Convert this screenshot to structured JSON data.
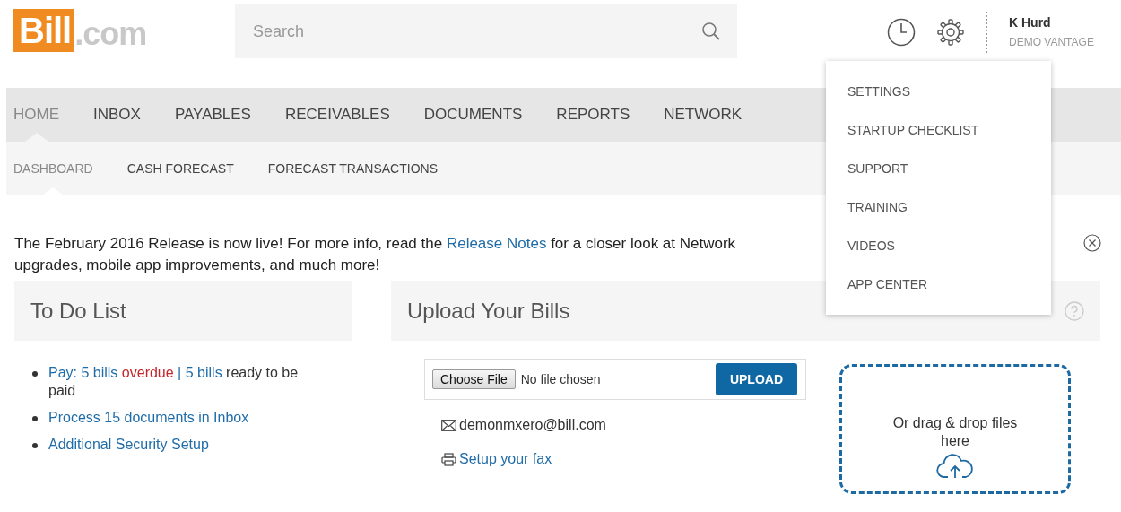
{
  "header": {
    "logo": {
      "brand": "Bill",
      "suffix": ".com"
    },
    "search": {
      "placeholder": "Search"
    },
    "user": {
      "name": "K Hurd",
      "company": "DEMO VANTAGE"
    }
  },
  "nav": {
    "items": [
      {
        "label": "HOME",
        "selected": true
      },
      {
        "label": "INBOX",
        "selected": false
      },
      {
        "label": "PAYABLES",
        "selected": false
      },
      {
        "label": "RECEIVABLES",
        "selected": false
      },
      {
        "label": "DOCUMENTS",
        "selected": false
      },
      {
        "label": "REPORTS",
        "selected": false
      },
      {
        "label": "NETWORK",
        "selected": false
      }
    ]
  },
  "subnav": {
    "items": [
      {
        "label": "DASHBOARD",
        "selected": true
      },
      {
        "label": "CASH FORECAST",
        "selected": false
      },
      {
        "label": "FORECAST TRANSACTIONS",
        "selected": false
      }
    ]
  },
  "settings_menu": {
    "items": [
      "SETTINGS",
      "STARTUP CHECKLIST",
      "SUPPORT",
      "TRAINING",
      "VIDEOS",
      "APP CENTER"
    ]
  },
  "announcement": {
    "before": "The February 2016 Release is now live! For more info, read the",
    "link": "Release Notes",
    "after": "for a closer look at Network",
    "line_2": "upgrades, mobile app improvements, and much more!"
  },
  "todo": {
    "title": "To Do List",
    "items": [
      {
        "parts": [
          {
            "kind": "link",
            "text": "Pay: 5 bills"
          },
          {
            "kind": "alert",
            "text": "overdue"
          },
          {
            "kind": "link",
            "text": "|"
          },
          {
            "kind": "link",
            "text": "5 bills"
          },
          {
            "kind": "plain",
            "text": "ready to be paid"
          }
        ]
      },
      {
        "parts": [
          {
            "kind": "link",
            "text": "Process 15 documents in Inbox"
          }
        ]
      },
      {
        "parts": [
          {
            "kind": "link",
            "text": "Additional Security Setup"
          }
        ]
      }
    ]
  },
  "upload": {
    "title": "Upload Your Bills",
    "choose_button": "Choose File",
    "file_status": "No file chosen",
    "upload_button": "UPLOAD",
    "email": "demonmxero@bill.com",
    "fax_link": "Setup your fax",
    "drop_text": "Or drag & drop files here"
  }
}
